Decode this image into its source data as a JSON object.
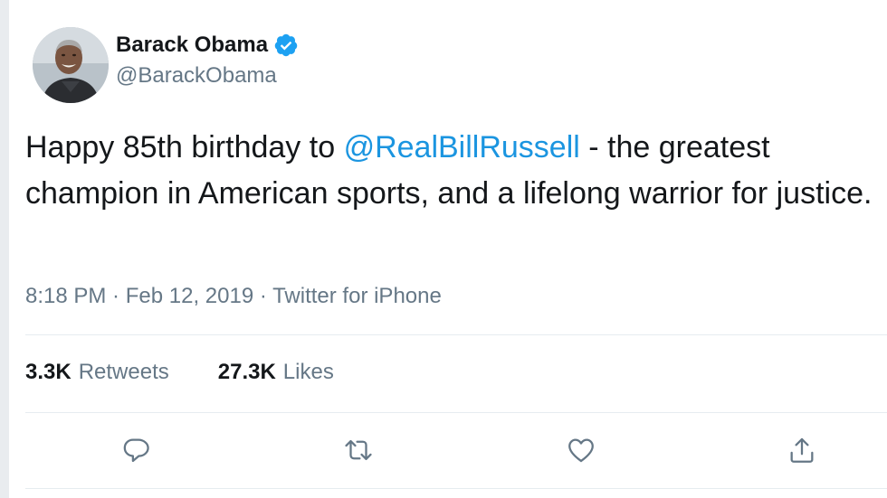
{
  "author": {
    "name": "Barack Obama",
    "handle": "@BarackObama",
    "verified": true
  },
  "tweet": {
    "text_before": "Happy 85th birthday to ",
    "mention": "@RealBillRussell",
    "text_after": " - the greatest champion in American sports, and a lifelong warrior for justice."
  },
  "meta": {
    "time": "8:18 PM",
    "separator1": " · ",
    "date": "Feb 12, 2019",
    "separator2": " · ",
    "source": "Twitter for iPhone"
  },
  "stats": {
    "retweets_count": "3.3K",
    "retweets_label": "Retweets",
    "likes_count": "27.3K",
    "likes_label": "Likes"
  },
  "actions": [
    {
      "icon": "reply-icon"
    },
    {
      "icon": "retweet-icon"
    },
    {
      "icon": "heart-icon"
    },
    {
      "icon": "share-icon"
    }
  ],
  "colors": {
    "text": "#14171a",
    "secondary": "#657786",
    "link": "#1b95e0",
    "verified": "#1da1f2",
    "divider": "#e6ecf0"
  }
}
